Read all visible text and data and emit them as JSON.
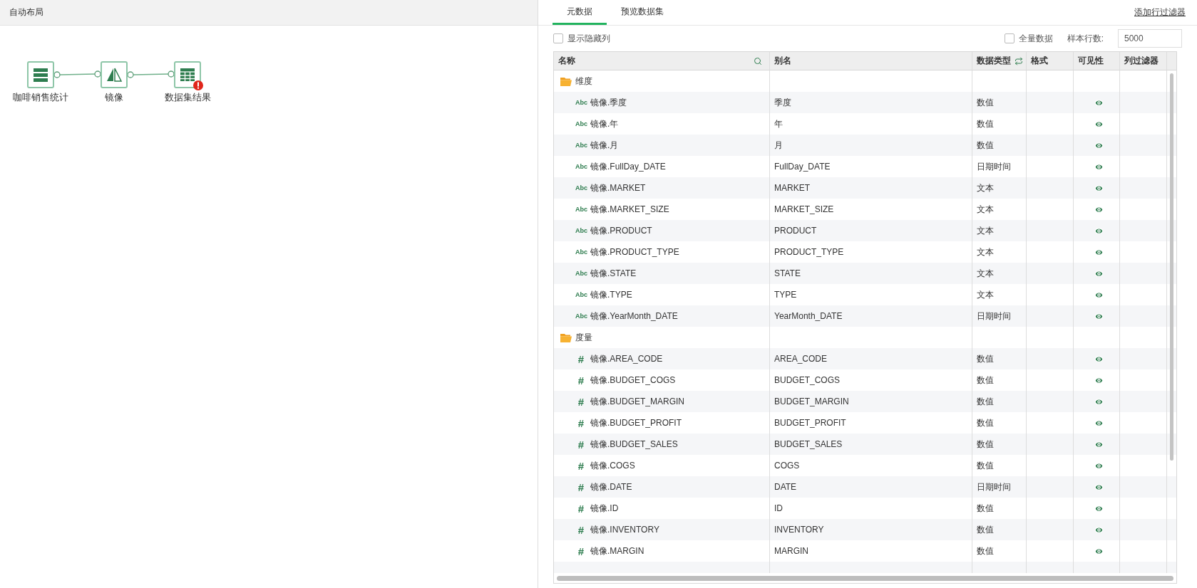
{
  "canvas": {
    "toolbar_title": "自动布局",
    "nodes": [
      {
        "label": "咖啡销售统计",
        "kind": "source",
        "error": false
      },
      {
        "label": "镜像",
        "kind": "mirror",
        "error": false
      },
      {
        "label": "数据集结果",
        "kind": "table",
        "error": true
      }
    ]
  },
  "tabs": [
    {
      "label": "元数据",
      "selected": true
    },
    {
      "label": "预览数据集",
      "selected": false
    }
  ],
  "add_filter_link": "添加行过滤器",
  "show_hidden": {
    "label": "显示隐藏列",
    "checked": false
  },
  "full_data": {
    "label": "全量数据",
    "checked": false
  },
  "sample_rows": {
    "label": "样本行数:",
    "value": "5000"
  },
  "table": {
    "columns": [
      "名称",
      "别名",
      "数据类型",
      "格式",
      "可见性",
      "列过滤器"
    ],
    "groups": [
      {
        "name": "维度",
        "children": [
          {
            "badge": "Abc",
            "name": "镜像.季度",
            "alias": "季度",
            "type": "数值",
            "visible": true
          },
          {
            "badge": "Abc",
            "name": "镜像.年",
            "alias": "年",
            "type": "数值",
            "visible": true
          },
          {
            "badge": "Abc",
            "name": "镜像.月",
            "alias": "月",
            "type": "数值",
            "visible": true
          },
          {
            "badge": "Abc",
            "name": "镜像.FullDay_DATE",
            "alias": "FullDay_DATE",
            "type": "日期时间",
            "visible": true
          },
          {
            "badge": "Abc",
            "name": "镜像.MARKET",
            "alias": "MARKET",
            "type": "文本",
            "visible": true
          },
          {
            "badge": "Abc",
            "name": "镜像.MARKET_SIZE",
            "alias": "MARKET_SIZE",
            "type": "文本",
            "visible": true
          },
          {
            "badge": "Abc",
            "name": "镜像.PRODUCT",
            "alias": "PRODUCT",
            "type": "文本",
            "visible": true
          },
          {
            "badge": "Abc",
            "name": "镜像.PRODUCT_TYPE",
            "alias": "PRODUCT_TYPE",
            "type": "文本",
            "visible": true
          },
          {
            "badge": "Abc",
            "name": "镜像.STATE",
            "alias": "STATE",
            "type": "文本",
            "visible": true
          },
          {
            "badge": "Abc",
            "name": "镜像.TYPE",
            "alias": "TYPE",
            "type": "文本",
            "visible": true
          },
          {
            "badge": "Abc",
            "name": "镜像.YearMonth_DATE",
            "alias": "YearMonth_DATE",
            "type": "日期时间",
            "visible": true
          }
        ]
      },
      {
        "name": "度量",
        "children": [
          {
            "badge": "#",
            "name": "镜像.AREA_CODE",
            "alias": "AREA_CODE",
            "type": "数值",
            "visible": true
          },
          {
            "badge": "#",
            "name": "镜像.BUDGET_COGS",
            "alias": "BUDGET_COGS",
            "type": "数值",
            "visible": true
          },
          {
            "badge": "#",
            "name": "镜像.BUDGET_MARGIN",
            "alias": "BUDGET_MARGIN",
            "type": "数值",
            "visible": true
          },
          {
            "badge": "#",
            "name": "镜像.BUDGET_PROFIT",
            "alias": "BUDGET_PROFIT",
            "type": "数值",
            "visible": true
          },
          {
            "badge": "#",
            "name": "镜像.BUDGET_SALES",
            "alias": "BUDGET_SALES",
            "type": "数值",
            "visible": true
          },
          {
            "badge": "#",
            "name": "镜像.COGS",
            "alias": "COGS",
            "type": "数值",
            "visible": true
          },
          {
            "badge": "#",
            "name": "镜像.DATE",
            "alias": "DATE",
            "type": "日期时间",
            "visible": true
          },
          {
            "badge": "#",
            "name": "镜像.ID",
            "alias": "ID",
            "type": "数值",
            "visible": true
          },
          {
            "badge": "#",
            "name": "镜像.INVENTORY",
            "alias": "INVENTORY",
            "type": "数值",
            "visible": true
          },
          {
            "badge": "#",
            "name": "镜像.MARGIN",
            "alias": "MARGIN",
            "type": "数值",
            "visible": true
          }
        ]
      }
    ]
  }
}
